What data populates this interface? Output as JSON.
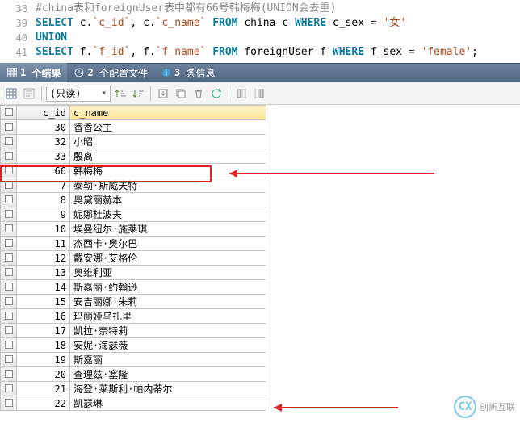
{
  "code": {
    "lines": [
      {
        "n": "38",
        "html": "<span class='cm'>#china表和foreignUser表中都有66号韩梅梅(UNION会去重)</span>"
      },
      {
        "n": "39",
        "html": "<span class='kw'>SELECT</span> c.<span class='str'>`c_id`</span>, c.<span class='str'>`c_name`</span> <span class='kw'>FROM</span> china c <span class='kw'>WHERE</span> c_sex <span class='op'>=</span> <span class='str'>'女'</span>"
      },
      {
        "n": "40",
        "html": "<span class='kw'>UNION</span>"
      },
      {
        "n": "41",
        "html": "<span class='kw'>SELECT</span> f.<span class='str'>`f_id`</span>, f.<span class='str'>`f_name`</span> <span class='kw'>FROM</span> foreignUser f <span class='kw'>WHERE</span> f_sex <span class='op'>=</span> <span class='str'>'female'</span>;"
      }
    ]
  },
  "tabs": {
    "results": {
      "count": "1",
      "label": "个结果"
    },
    "profiles": {
      "count": "2",
      "label": "个配置文件"
    },
    "messages": {
      "count": "3",
      "label": "条信息"
    }
  },
  "toolbar": {
    "readonly_label": "(只读)"
  },
  "grid": {
    "columns": {
      "c1": "c_id",
      "c2": "c_name"
    },
    "rows": [
      {
        "id": "30",
        "name": "香香公主",
        "hl": false
      },
      {
        "id": "32",
        "name": "小昭",
        "hl": false
      },
      {
        "id": "33",
        "name": "殷离",
        "hl": false
      },
      {
        "id": "66",
        "name": "韩梅梅",
        "hl": true
      },
      {
        "id": "7",
        "name": "泰勒·斯威夫特",
        "hl": false
      },
      {
        "id": "8",
        "name": "奥黛丽赫本",
        "hl": false
      },
      {
        "id": "9",
        "name": "妮娜杜波夫",
        "hl": false
      },
      {
        "id": "10",
        "name": "埃曼纽尔·施莱琪",
        "hl": false
      },
      {
        "id": "11",
        "name": "杰西卡·奥尔巴",
        "hl": false
      },
      {
        "id": "12",
        "name": "戴安娜·艾格伦",
        "hl": false
      },
      {
        "id": "13",
        "name": "奥维利亚",
        "hl": false
      },
      {
        "id": "14",
        "name": "斯嘉丽·约翰逊",
        "hl": false
      },
      {
        "id": "15",
        "name": "安吉丽娜·朱莉",
        "hl": false
      },
      {
        "id": "16",
        "name": "玛丽娅乌扎里",
        "hl": false
      },
      {
        "id": "17",
        "name": "凯拉·奈特莉",
        "hl": false
      },
      {
        "id": "18",
        "name": "安妮·海瑟薇",
        "hl": false
      },
      {
        "id": "19",
        "name": "斯嘉丽",
        "hl": false
      },
      {
        "id": "20",
        "name": "查理兹·塞隆",
        "hl": false
      },
      {
        "id": "21",
        "name": "海登·莱斯利·帕内蒂尔",
        "hl": false
      },
      {
        "id": "22",
        "name": "凯瑟琳",
        "hl": false
      }
    ]
  },
  "watermark": {
    "text": "创新互联"
  }
}
